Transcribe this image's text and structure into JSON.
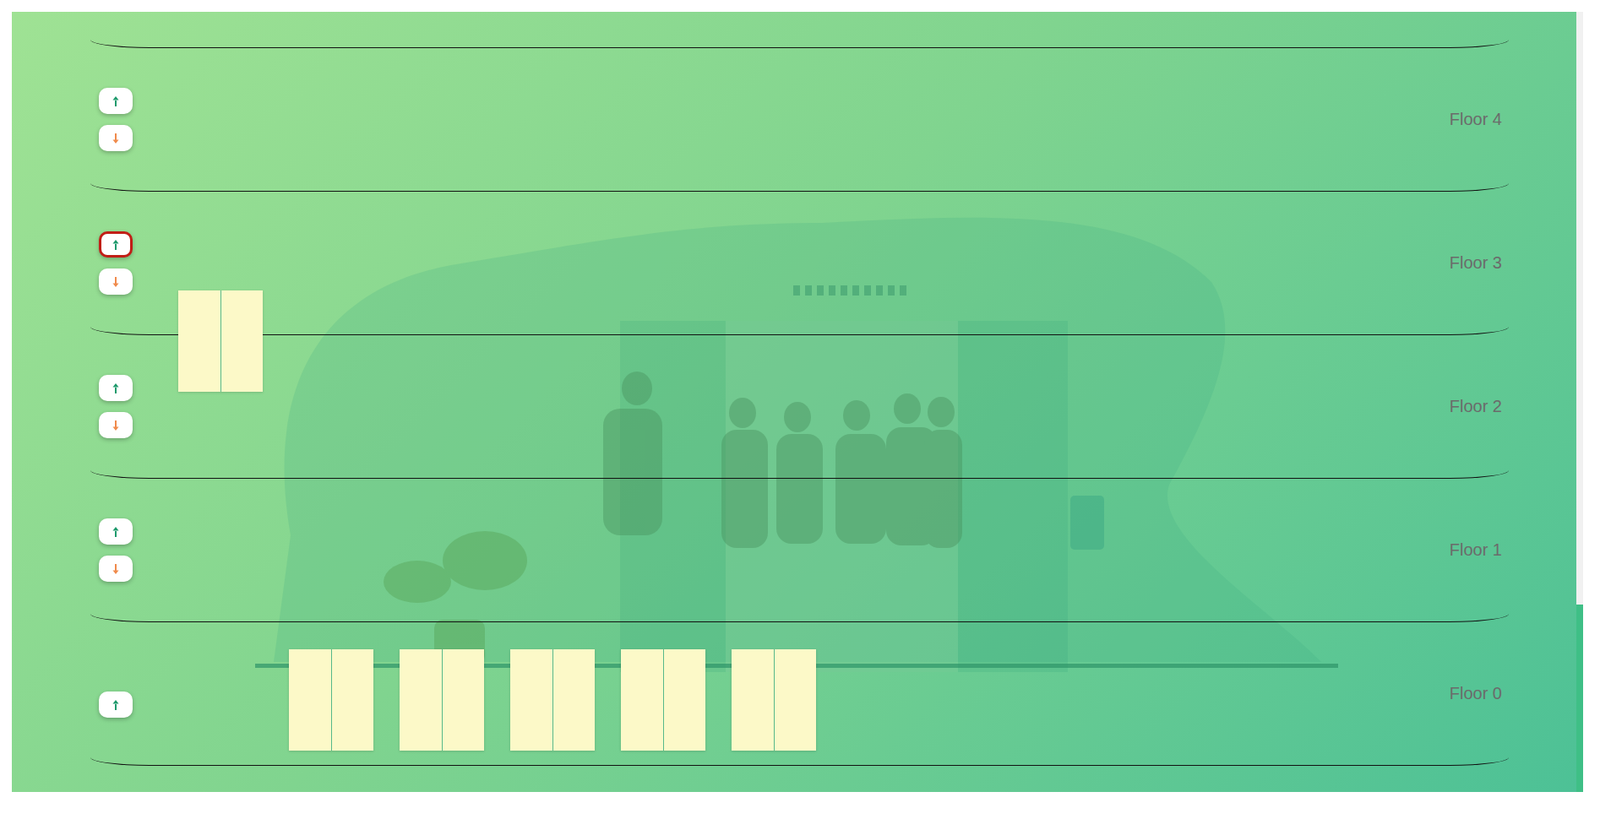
{
  "floors": [
    {
      "label": "Floor 4",
      "buttons": [
        {
          "kind": "up",
          "pressed": false
        },
        {
          "kind": "down",
          "pressed": false
        }
      ]
    },
    {
      "label": "Floor 3",
      "buttons": [
        {
          "kind": "up",
          "pressed": true
        },
        {
          "kind": "down",
          "pressed": false
        }
      ]
    },
    {
      "label": "Floor 2",
      "buttons": [
        {
          "kind": "up",
          "pressed": false
        },
        {
          "kind": "down",
          "pressed": false
        }
      ]
    },
    {
      "label": "Floor 1",
      "buttons": [
        {
          "kind": "up",
          "pressed": false
        },
        {
          "kind": "down",
          "pressed": false
        }
      ]
    },
    {
      "label": "Floor 0",
      "buttons": [
        {
          "kind": "up",
          "pressed": false
        }
      ]
    }
  ],
  "lifts": [
    {
      "level": 0.625
    },
    {
      "level": 0
    },
    {
      "level": 0
    },
    {
      "level": 0
    },
    {
      "level": 0
    },
    {
      "level": 0
    }
  ]
}
